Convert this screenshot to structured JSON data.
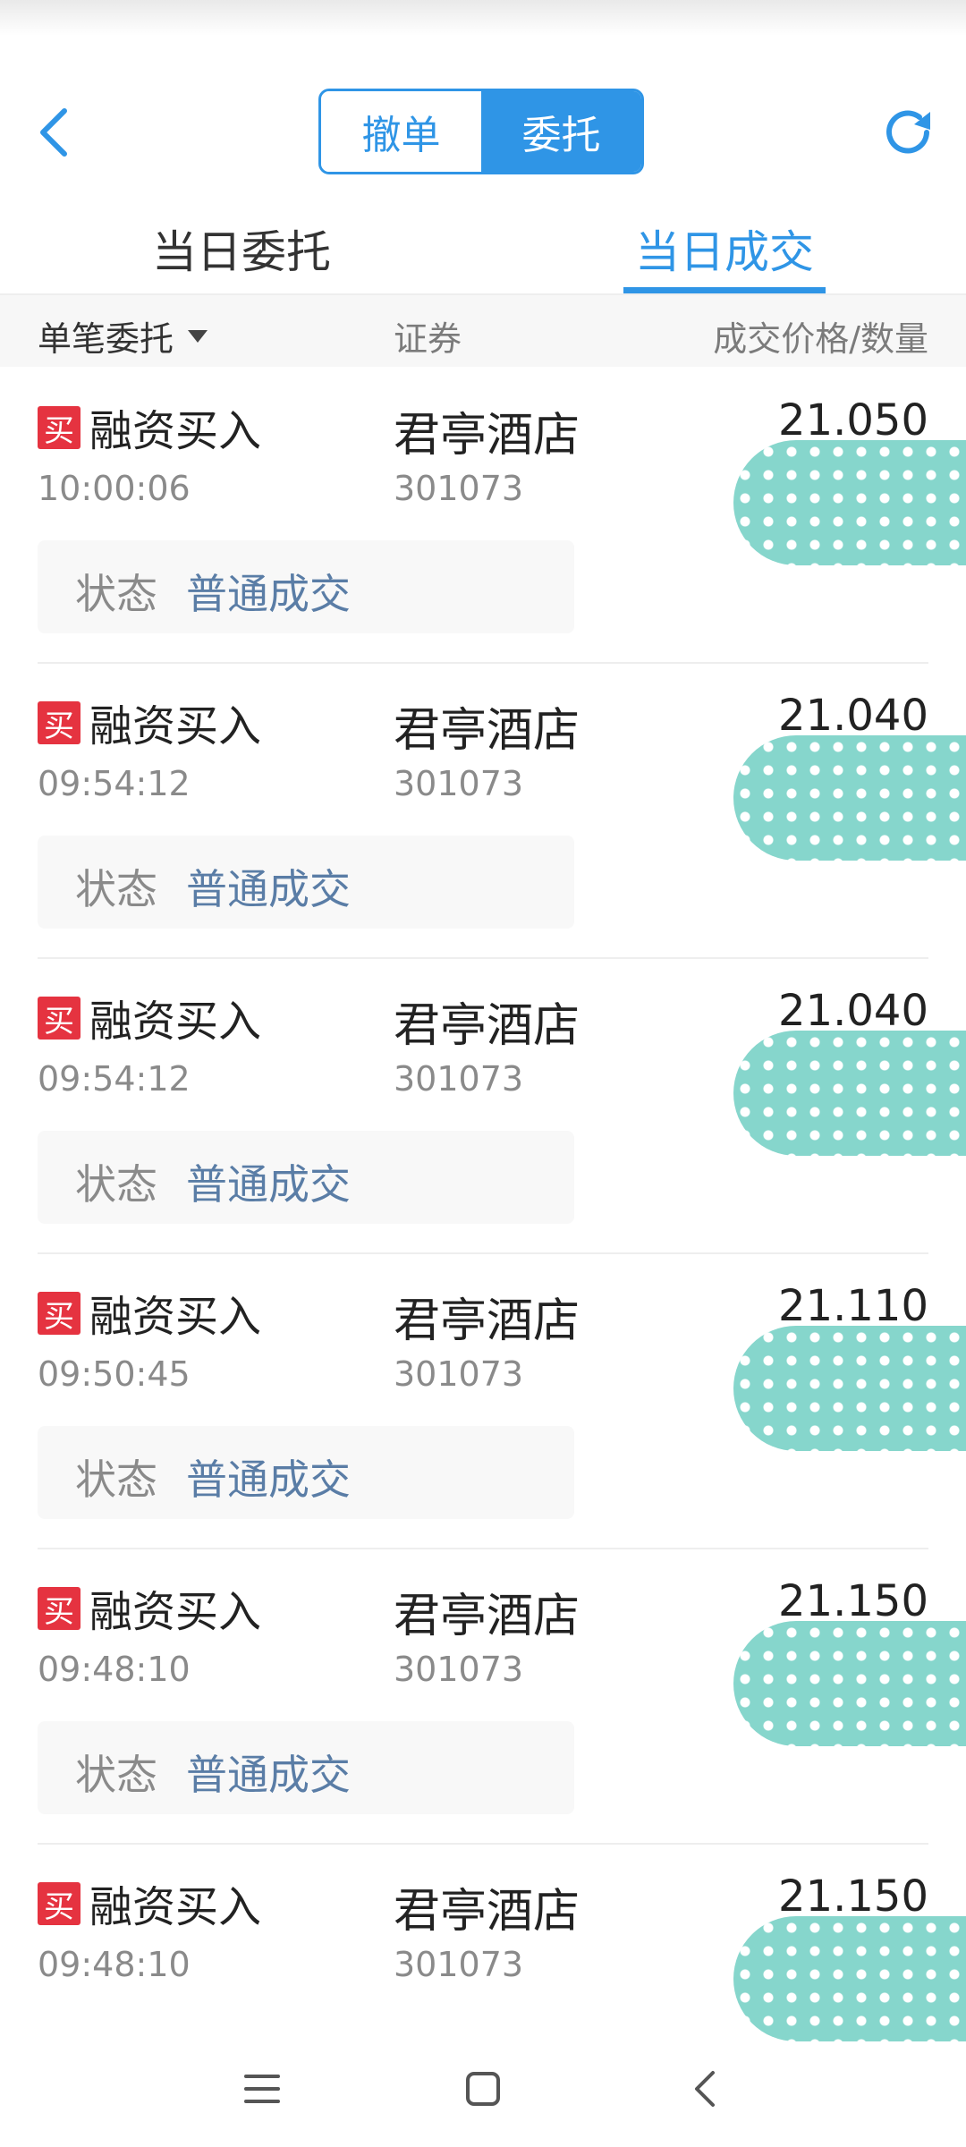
{
  "header": {
    "segments": [
      {
        "label": "撤单",
        "active": false
      },
      {
        "label": "委托",
        "active": true
      }
    ]
  },
  "tabs": [
    {
      "label": "当日委托",
      "active": false
    },
    {
      "label": "当日成交",
      "active": true
    }
  ],
  "columns": {
    "col1": "单笔委托",
    "col2": "证券",
    "col3": "成交价格/数量"
  },
  "rows": [
    {
      "badge": "买",
      "op": "融资买入",
      "time": "10:00:06",
      "name": "君亭酒店",
      "code": "301073",
      "price": "21.050",
      "status_label": "状态",
      "status": "普通成交"
    },
    {
      "badge": "买",
      "op": "融资买入",
      "time": "09:54:12",
      "name": "君亭酒店",
      "code": "301073",
      "price": "21.040",
      "status_label": "状态",
      "status": "普通成交"
    },
    {
      "badge": "买",
      "op": "融资买入",
      "time": "09:54:12",
      "name": "君亭酒店",
      "code": "301073",
      "price": "21.040",
      "status_label": "状态",
      "status": "普通成交"
    },
    {
      "badge": "买",
      "op": "融资买入",
      "time": "09:50:45",
      "name": "君亭酒店",
      "code": "301073",
      "price": "21.110",
      "status_label": "状态",
      "status": "普通成交"
    },
    {
      "badge": "买",
      "op": "融资买入",
      "time": "09:48:10",
      "name": "君亭酒店",
      "code": "301073",
      "price": "21.150",
      "status_label": "状态",
      "status": "普通成交"
    },
    {
      "badge": "买",
      "op": "融资买入",
      "time": "09:48:10",
      "name": "君亭酒店",
      "code": "301073",
      "price": "21.150",
      "status_label": "状态",
      "status": "普通成交"
    }
  ],
  "icons": {
    "back": "chevron-left-icon",
    "refresh": "refresh-icon",
    "nav": [
      "menu-icon",
      "home-icon",
      "back-icon"
    ]
  },
  "colors": {
    "accent": "#2f95e6",
    "buy": "#e53340",
    "status": "#5a7da6",
    "redaction": "#86d6cc"
  }
}
